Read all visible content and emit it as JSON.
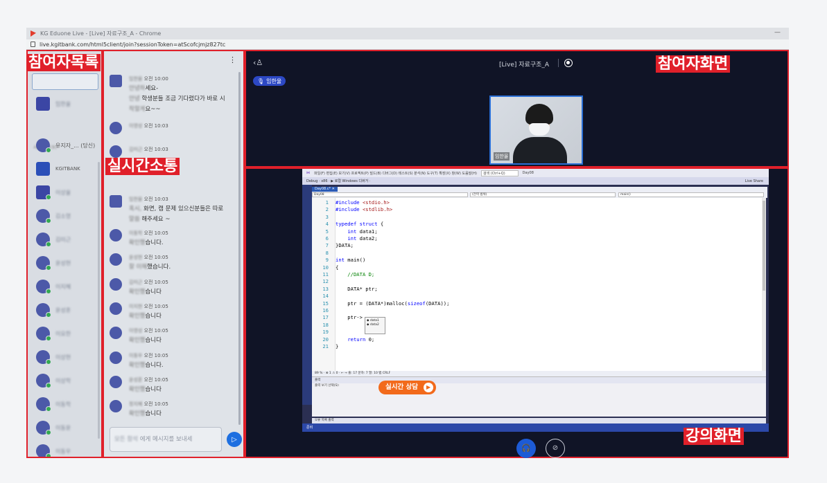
{
  "browser": {
    "title": "KG Eduone Live - [Live] 자료구조_A - Chrome",
    "url": "live.kgitbank.com/html5client/join?sessionToken=atScofcjmjz827tc"
  },
  "participants": {
    "self_label": "유지자_... (당신)",
    "section_label": "사용자(19)",
    "bank_label": "KGITBANK",
    "names": [
      "모든 사용",
      "임한율",
      "유지자",
      "KGITBANK",
      "이상율",
      "김소영",
      "김미근",
      "윤성현",
      "이지혜",
      "윤성훈",
      "이요한",
      "이상현",
      "이상학",
      "이동학",
      "이동윤",
      "이동우"
    ]
  },
  "chat": {
    "menu_icon": "more-vertical-icon",
    "messages": [
      {
        "name": "임한율",
        "time": "오전 10:00",
        "lines": [
          {
            "blur": "안녕하",
            "text": "세요-"
          },
          {
            "blur": "안녕",
            "text": "학생분들 조금 기다렸다가 바로 시"
          },
          {
            "blur": "작할게",
            "text": "요~~"
          }
        ]
      },
      {
        "name": "이영성",
        "time": "오전 10:03",
        "lines": []
      },
      {
        "name": "김미근",
        "time": "오전 10:03",
        "lines": []
      },
      {
        "name": "임한율",
        "time": "오전 10:03",
        "lines": [
          {
            "blur": "혹시,",
            "text": "화면, 캠 문제 있으신분들은 따로"
          },
          {
            "blur": "말씀",
            "text": "해주세요 ~"
          }
        ]
      },
      {
        "name": "이동학",
        "time": "오전 10:05",
        "lines": [
          {
            "blur": "확인했",
            "text": "습니다."
          }
        ]
      },
      {
        "name": "윤성현",
        "time": "오전 10:05",
        "lines": [
          {
            "blur": "잘 이해",
            "text": "했습니다."
          }
        ]
      },
      {
        "name": "김미근",
        "time": "오전 10:05",
        "lines": [
          {
            "blur": "확인했",
            "text": "습니다"
          }
        ]
      },
      {
        "name": "이지현",
        "time": "오전 10:05",
        "lines": [
          {
            "blur": "확인했",
            "text": "습니다"
          }
        ]
      },
      {
        "name": "이영성",
        "time": "오전 10:05",
        "lines": [
          {
            "blur": "확인했",
            "text": "습니다"
          }
        ]
      },
      {
        "name": "이동우",
        "time": "오전 10:05",
        "lines": [
          {
            "blur": "확인했",
            "text": "습니다."
          }
        ]
      },
      {
        "name": "윤성훈",
        "time": "오전 10:05",
        "lines": [
          {
            "blur": "확인했",
            "text": "습니다"
          }
        ]
      },
      {
        "name": "정지혜",
        "time": "오전 10:05",
        "lines": [
          {
            "blur": "확인했",
            "text": "습니다"
          }
        ]
      }
    ],
    "input_placeholder_blur": "모든 참석",
    "input_placeholder": "에게 메시지를 보내세"
  },
  "video": {
    "title": "[Live] 자료구조_A",
    "speaker": "임한율",
    "cam_name": "임한율"
  },
  "ide": {
    "title_text": "파일(F) 편집(E) 보기(V) 프로젝트(P) 빌드(B) 디버그(D) 테스트(S) 분석(N) 도구(T) 확장(X) 창(W) 도움말(H)",
    "search": "검색 (Ctrl+Q)",
    "project": "Day08",
    "toolbar": "Debug · x86 · ▶ 로컬 Windows 디버거 ·",
    "live_share": "Live Share",
    "tab": "Day08.c* ✕",
    "dd1": "Day08",
    "dd2": "(전역 범위)",
    "dd3": "main()",
    "code": [
      {
        "n": "1",
        "s": "#include <stdio.h>"
      },
      {
        "n": "2",
        "s": "#include <stdlib.h>"
      },
      {
        "n": "3",
        "s": ""
      },
      {
        "n": "4",
        "s": "typedef struct {"
      },
      {
        "n": "5",
        "s": "    int data1;"
      },
      {
        "n": "6",
        "s": "    int data2;"
      },
      {
        "n": "7",
        "s": "}DATA;"
      },
      {
        "n": "8",
        "s": ""
      },
      {
        "n": "9",
        "s": "int main()"
      },
      {
        "n": "10",
        "s": "{"
      },
      {
        "n": "11",
        "s": "    //DATA D;"
      },
      {
        "n": "12",
        "s": ""
      },
      {
        "n": "13",
        "s": "    DATA* ptr;"
      },
      {
        "n": "14",
        "s": ""
      },
      {
        "n": "15",
        "s": "    ptr = (DATA*)malloc(sizeof(DATA));"
      },
      {
        "n": "16",
        "s": ""
      },
      {
        "n": "17",
        "s": "    ptr->"
      },
      {
        "n": "18",
        "s": ""
      },
      {
        "n": "19",
        "s": ""
      },
      {
        "n": "20",
        "s": "    return 0;"
      },
      {
        "n": "21",
        "s": "}"
      }
    ],
    "autocomplete": [
      "data1",
      "data2"
    ],
    "status": "89 %  ·  ⊗ 1  ⚠ 0  ·  ← →        줄: 17   문자: 7   열: 10   탭   CRLF",
    "output_head": "출력",
    "output_sub": "출력 보기 선택(S):",
    "bottom_tabs": "오류 목록  출력",
    "statusbar": "준비"
  },
  "lecture": {
    "consult_label": "실시간 상담",
    "consult_arrow": "▶"
  },
  "annotations": {
    "participants": "참여자목록",
    "live": "실시간소통",
    "screen": "참여자화면",
    "lecture": "강의화면"
  },
  "colors": {
    "accent_red": "#e0202a",
    "brand_blue": "#1d5bd6",
    "consult_orange": "#f26a1b"
  }
}
